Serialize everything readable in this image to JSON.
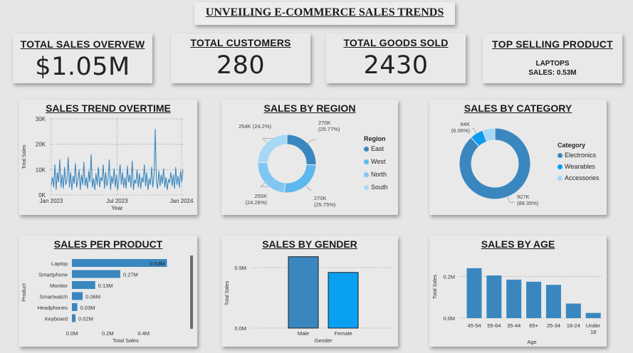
{
  "header": {
    "title": "UNVEILING E-COMMERCE SALES TRENDS"
  },
  "kpis": {
    "total_sales": {
      "title": "TOTAL SALES OVERVEW",
      "value": "$1.05M"
    },
    "total_customers": {
      "title": "TOTAL CUSTOMERS",
      "value": "280"
    },
    "total_goods": {
      "title": "TOTAL GOODS SOLD",
      "value": "2430"
    },
    "top_product": {
      "title": "TOP SELLING PRODUCT",
      "line1": "LAPTOPS",
      "line2": "SALES: 0.53M"
    }
  },
  "colors": {
    "primary": "#3a87c0",
    "east": "#3a87c0",
    "west": "#5cb8ef",
    "north": "#7fc6f2",
    "south": "#a6d8f6",
    "electronics": "#3a87c0",
    "wearables": "#0d9bf0",
    "accessories": "#a6d8f6",
    "male": "#3a87c0",
    "female": "#0aa0f2"
  },
  "chart_data": [
    {
      "id": "trend",
      "type": "line",
      "title": "SALES TREND OVERTIME",
      "xlabel": "Year",
      "ylabel": "Total Sales",
      "x_ticks": [
        "Jan 2023",
        "Jul 2023",
        "Jan 2024"
      ],
      "y_ticks": [
        "0K",
        "10K",
        "20K",
        "30K"
      ],
      "ylim": [
        0,
        30000
      ],
      "grid": true,
      "values": [
        4000,
        7000,
        3000,
        12000,
        2000,
        9000,
        5000,
        14000,
        3000,
        8000,
        2500,
        11000,
        4000,
        6000,
        15000,
        3000,
        9000,
        2000,
        7500,
        4500,
        12500,
        3000,
        6000,
        10000,
        2000,
        8000,
        4000,
        13000,
        3500,
        7000,
        2500,
        9500,
        5000,
        16000,
        3000,
        6500,
        2000,
        8500,
        4000,
        11000,
        3000,
        7000,
        5500,
        12000,
        2500,
        9000,
        3500,
        6000,
        14000,
        2000,
        7500,
        4500,
        10500,
        3000,
        8000,
        2000,
        6500,
        12000,
        4000,
        9000,
        3000,
        7000,
        2500,
        11500,
        5000,
        8000,
        3000,
        13500,
        2000,
        6000,
        4500,
        10000,
        3000,
        8500,
        2500,
        7000,
        5000,
        12000,
        3500,
        9000,
        2000,
        6500,
        4000,
        11000,
        3000,
        7500,
        26000,
        5000,
        2500,
        9500,
        3500,
        8000,
        4500,
        10500,
        3000,
        7000,
        2000,
        6000,
        5000,
        9000,
        3500,
        8000,
        2500,
        11000,
        4000,
        7500,
        3000,
        9500,
        5000,
        10000
      ]
    },
    {
      "id": "region",
      "type": "pie",
      "title": "SALES BY REGION",
      "legend_title": "Region",
      "legend_position": "right",
      "labels": [
        "East",
        "West",
        "North",
        "South"
      ],
      "values": [
        270000,
        270000,
        255000,
        254000
      ],
      "data_labels": [
        [
          "270K",
          "(25.77%)"
        ],
        [
          "270K",
          "(25.75%)"
        ],
        [
          "255K",
          "(24.28%)"
        ],
        [
          "254K (24.2%)"
        ]
      ]
    },
    {
      "id": "category",
      "type": "pie",
      "title": "SALES BY CATEGORY",
      "legend_title": "Category",
      "legend_position": "right",
      "labels": [
        "Electronics",
        "Wearables",
        "Accessories"
      ],
      "values": [
        927000,
        64000,
        59000
      ],
      "data_labels": [
        [
          "927K",
          "(88.35%)"
        ],
        [
          "64K",
          "(6.06%)"
        ],
        []
      ]
    },
    {
      "id": "product",
      "type": "bar",
      "orientation": "horizontal",
      "title": "SALES PER PRODUCT",
      "xlabel": "Total Sales",
      "ylabel": "Product",
      "categories": [
        "Laptop",
        "Smartphone",
        "Monitor",
        "Smartwatch",
        "Headphones",
        "Keyboard"
      ],
      "values": [
        0.53,
        0.27,
        0.13,
        0.06,
        0.03,
        0.02
      ],
      "data_labels": [
        "0.53M",
        "0.27M",
        "0.13M",
        "0.06M",
        "0.03M",
        "0.02M"
      ],
      "x_ticks": [
        "0.0M",
        "0.2M",
        "0.4M"
      ],
      "xlim": [
        0,
        0.6
      ]
    },
    {
      "id": "gender",
      "type": "bar",
      "title": "SALES BY GENDER",
      "xlabel": "Gender",
      "ylabel": "Total Sales",
      "categories": [
        "Male",
        "Female"
      ],
      "values": [
        0.59,
        0.46
      ],
      "y_ticks": [
        "0.0M",
        "0.5M"
      ],
      "ylim": [
        0,
        0.6
      ],
      "grid": true
    },
    {
      "id": "age",
      "type": "bar",
      "title": "SALES BY AGE",
      "xlabel": "Age",
      "ylabel": "Total Sales",
      "categories": [
        "45-54",
        "55-64",
        "35-44",
        "65+",
        "25-34",
        "18-24",
        "Under 18"
      ],
      "values": [
        0.24,
        0.205,
        0.185,
        0.175,
        0.16,
        0.07,
        0.025
      ],
      "y_ticks": [
        "0.0M",
        "0.2M"
      ],
      "ylim": [
        0,
        0.26
      ],
      "grid": true
    }
  ]
}
